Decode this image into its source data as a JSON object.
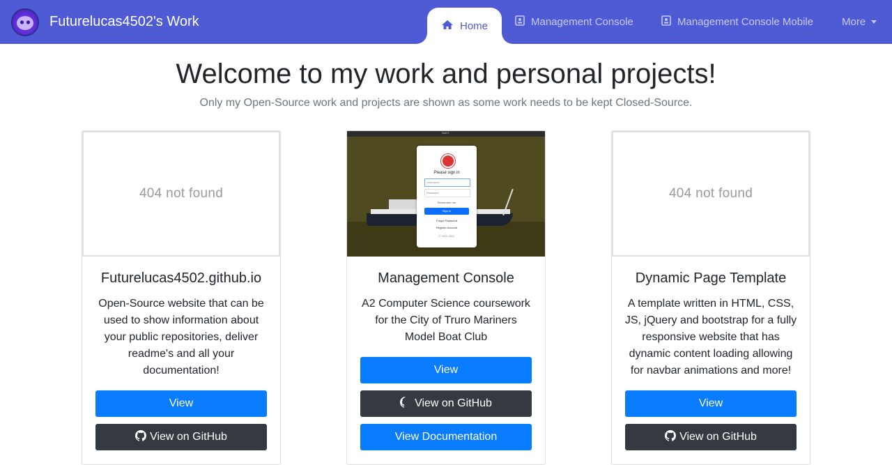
{
  "navbar": {
    "brand_title": "Futurelucas4502's Work",
    "tabs": [
      {
        "label": "Home",
        "icon": "home-icon",
        "active": true
      },
      {
        "label": "Management Console",
        "icon": "id-badge-icon",
        "active": false
      },
      {
        "label": "Management Console Mobile",
        "icon": "id-badge-icon",
        "active": false
      },
      {
        "label": "More",
        "icon": "caret-down-icon",
        "active": false
      }
    ],
    "colors": {
      "background": "#4f5bd5",
      "tab_text": "#c7cbf3",
      "active_text": "#4f5bd5"
    }
  },
  "page": {
    "title": "Welcome to my work and personal projects!",
    "subtitle": "Only my Open-Source work and projects are shown as some work needs to be kept Closed-Source."
  },
  "cards": [
    {
      "image_text": "404 not found",
      "title": "Futurelucas4502.github.io",
      "description": "Open-Source website that can be used to show information about your public repositories, deliver readme's and all your documentation!",
      "buttons": [
        "View",
        "View on GitHub"
      ]
    },
    {
      "image": {
        "top_bar": "Sail ©",
        "heading": "Please sign in",
        "username_placeholder": "Username",
        "password_placeholder": "Password",
        "remember": "Remember me",
        "sign_in": "Sign in",
        "link_1": "Forgot Password",
        "link_2": "Register Account",
        "footer": "© 2020-2021"
      },
      "title": "Management Console",
      "description": "A2 Computer Science coursework for the City of Truro Mariners Model Boat Club",
      "buttons": [
        "View",
        "View on GitHub",
        "View Documentation"
      ]
    },
    {
      "image_text": "404 not found",
      "title": "Dynamic Page Template",
      "description": "A template written in HTML, CSS, JS, jQuery and bootstrap for a fully responsive website that has dynamic content loading allowing for navbar animations and more!",
      "buttons": [
        "View",
        "View on GitHub"
      ]
    }
  ],
  "colors": {
    "primary": "#0a7cff",
    "dark": "#343a40"
  }
}
